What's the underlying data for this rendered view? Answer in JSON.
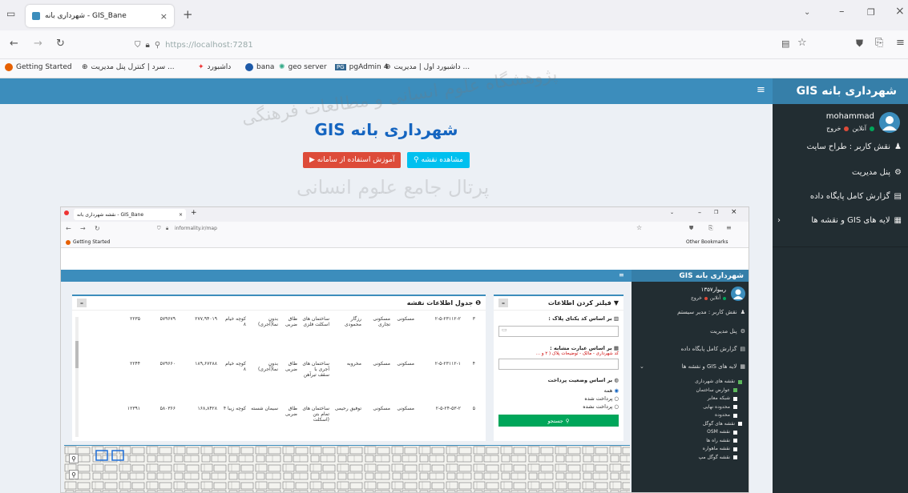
{
  "browser": {
    "tab_title": "شهرداری بانه - GIS_Bane",
    "url": "https://localhost:7281",
    "bookmarks": [
      "Getting Started",
      "سرد | کنترل پنل مدیریت ...",
      "داشبورد",
      "bana",
      "geo server",
      "pgAdmin 4",
      "داشبورد اول | مدیریت ..."
    ]
  },
  "site": {
    "brand": "GIS شهرداری بانه",
    "heading": "GIS شهرداری بانه",
    "btn_tutorial": "آموزش استفاده از سامانه",
    "btn_map": "مشاهده نقشه",
    "watermark_1": "پژوهشگاه علوم انسانی و مطالعات فرهنگی",
    "watermark_2": "پرتال جامع علوم انسانی"
  },
  "sidebar": {
    "username": "mohammad",
    "status_online": "آنلاین",
    "logout": "خروج",
    "role": "نقش کاربر : طراح سایت",
    "items": [
      "پنل مدیریت",
      "گزارش کامل پایگاه داده",
      "لایه های GIS و نقشه ها"
    ]
  },
  "inner": {
    "tab_title": "نقشه شهرداری بانه - GIS_Bane",
    "url": "informality.ir/map",
    "bookmark": "Getting Started",
    "other_bookmarks": "Other Bookmarks",
    "brand": "GIS شهرداری بانه",
    "user": "ریبوار۱۳۵۷",
    "status_online": "آنلاین",
    "logout": "خروج",
    "role": "نقش کاربر : مدیر سیستم",
    "side_items": [
      "پنل مدیریت",
      "گزارش کامل پایگاه داده",
      "لایه های GIS و نقشه ها"
    ],
    "layers": [
      "نقشه های شهرداری",
      "عوارض ساختمان",
      "شبکه معابر",
      "محدوده نهایی",
      "محدوده",
      "نقشه های گوگل",
      "نقشه OSM",
      "نقشه راه ها",
      "نقشه ماهواره",
      "نقشه گوگل مپ"
    ],
    "filter_title": "فیلتر کردن اطلاعات",
    "by_plate": "بر اساس کد یکتای پلاک :",
    "by_phrase": "بر اساس عبارت مشابه :",
    "phrase_hint": "کد شهرداری - مالک - توضیحات پلاک ( ۲ و ...",
    "by_payment": "بر اساس وضعیت پرداخت",
    "radio_all": "همه",
    "radio_paid": "پرداخت شده",
    "radio_unpaid": "پرداخت نشده",
    "search_btn": "جستجو",
    "table_title": "جدول اطلاعات نقشه",
    "rows": [
      {
        "n": "۳",
        "code": "۲-۵-۲۳۱۱۲-۲",
        "c1": "مسکونی",
        "c2": "مسکونی تجاری",
        "c3": "رزگار محمودی",
        "c4": "ساختمان های اسکلت فلزی",
        "c5": "طاق ضربی",
        "c6": "بدون نما(آجری)",
        "c7": "کوچه خیام ۸",
        "v1": "۲۷۷,۹۴۰۱۹",
        "v2": "۵۷۹۶۷۹",
        "v3": "۲۲۳۵"
      },
      {
        "n": "۴",
        "code": "۲-۵-۲۳۱۱۲-۱",
        "c1": "مسکونی",
        "c2": "مسکونی",
        "c3": "مخروبه",
        "c4": "ساختمان های آجری با سقف تیرآهن",
        "c5": "طاق ضربی",
        "c6": "بدون نما(آجری)",
        "c7": "کوچه خیام ۸",
        "v1": "۱۸۹,۶۷۲۸۸",
        "v2": "۵۷۹۶۶۰",
        "v3": "۲۲۴۴"
      },
      {
        "n": "۵",
        "code": "۲-۵-۲۴-۵۳-۲",
        "c1": "مسکونی",
        "c2": "مسکونی",
        "c3": "توفیق رحیمی",
        "c4": "ساختمان های تمام بتن (اسکلت",
        "c5": "طاق ضربی",
        "c6": "سیمان شسته",
        "c7": "کوچه زیبا ۴",
        "v1": "۱۶۸,۸۴۲۸",
        "v2": "۵۸۰۳۶۶",
        "v3": "۱۲۳۹۱"
      }
    ]
  }
}
